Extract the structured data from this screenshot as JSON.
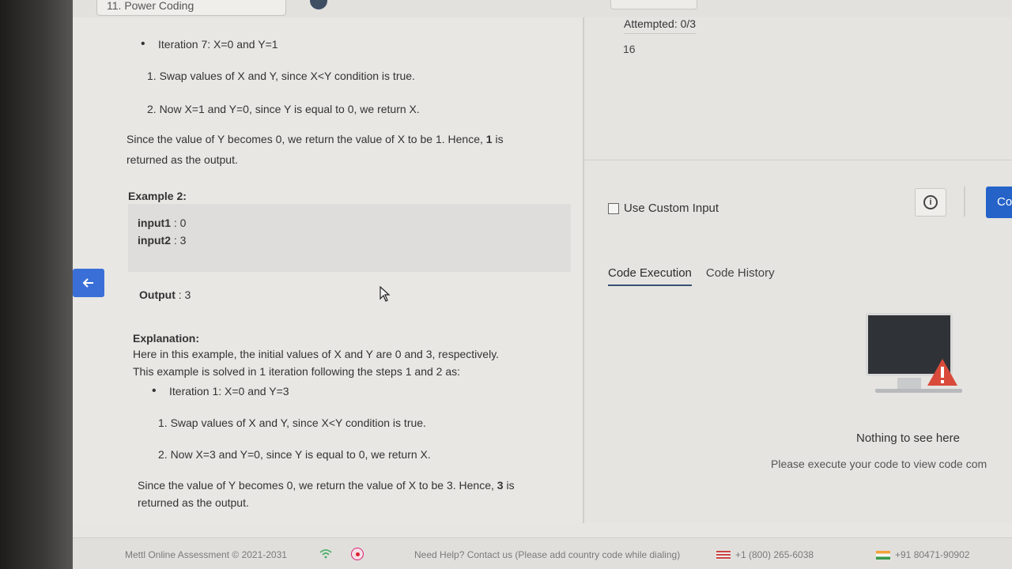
{
  "header": {
    "problem_title": "11. Power Coding"
  },
  "problem": {
    "ex1_iteration": "Iteration 7: X=0 and Y=1",
    "ex1_step1": "1. Swap values of X and Y, since X<Y condition is true.",
    "ex1_step2": "2. Now X=1 and Y=0, since Y is equal to 0, we return X.",
    "ex1_conclusion_line1_pre": "Since the value of Y becomes 0, we return the value of X to be 1. Hence, ",
    "ex1_conclusion_value": "1",
    "ex1_conclusion_line1_post": " is",
    "ex1_conclusion_line2": "returned as the output.",
    "example2_title": "Example 2:",
    "input1_label": "input1",
    "input1_value": ": 0",
    "input2_label": "input2",
    "input2_value": ": 3",
    "output_label": "Output",
    "output_value": ": 3",
    "explanation_title": "Explanation:",
    "explanation_line1": "Here in this example, the initial values of X and Y are 0 and 3, respectively.",
    "explanation_line2": "This example is solved in 1 iteration following the steps 1 and 2 as:",
    "ex2_iteration": "Iteration 1: X=0 and Y=3",
    "ex2_step1": "1. Swap values of X and Y, since X<Y condition is true.",
    "ex2_step2": "2. Now X=3 and Y=0, since Y is equal to 0, we return X.",
    "ex2_conclusion_line1_pre": "Since the value of Y becomes 0, we return the value of X to be 3. Hence, ",
    "ex2_conclusion_value": "3",
    "ex2_conclusion_line1_post": " is",
    "ex2_conclusion_line2": "returned as the output."
  },
  "editor": {
    "attempted": "Attempted: 0/3",
    "line_number": "16",
    "custom_input_label": "Use Custom Input",
    "compile_label": "Co"
  },
  "tabs": {
    "code_execution": "Code Execution",
    "code_history": "Code History"
  },
  "empty_state": {
    "title": "Nothing to see here",
    "message": "Please execute your code to view code com"
  },
  "footer": {
    "copyright": "Mettl Online Assessment © 2021-2031",
    "help": "Need Help? Contact us (Please add country code while dialing)",
    "us_phone": "+1 (800) 265-6038",
    "in_phone": "+91 80471-90902"
  },
  "colors": {
    "accent": "#2563c9",
    "back_button": "#3a6fd8",
    "warning": "#d94a3a"
  }
}
